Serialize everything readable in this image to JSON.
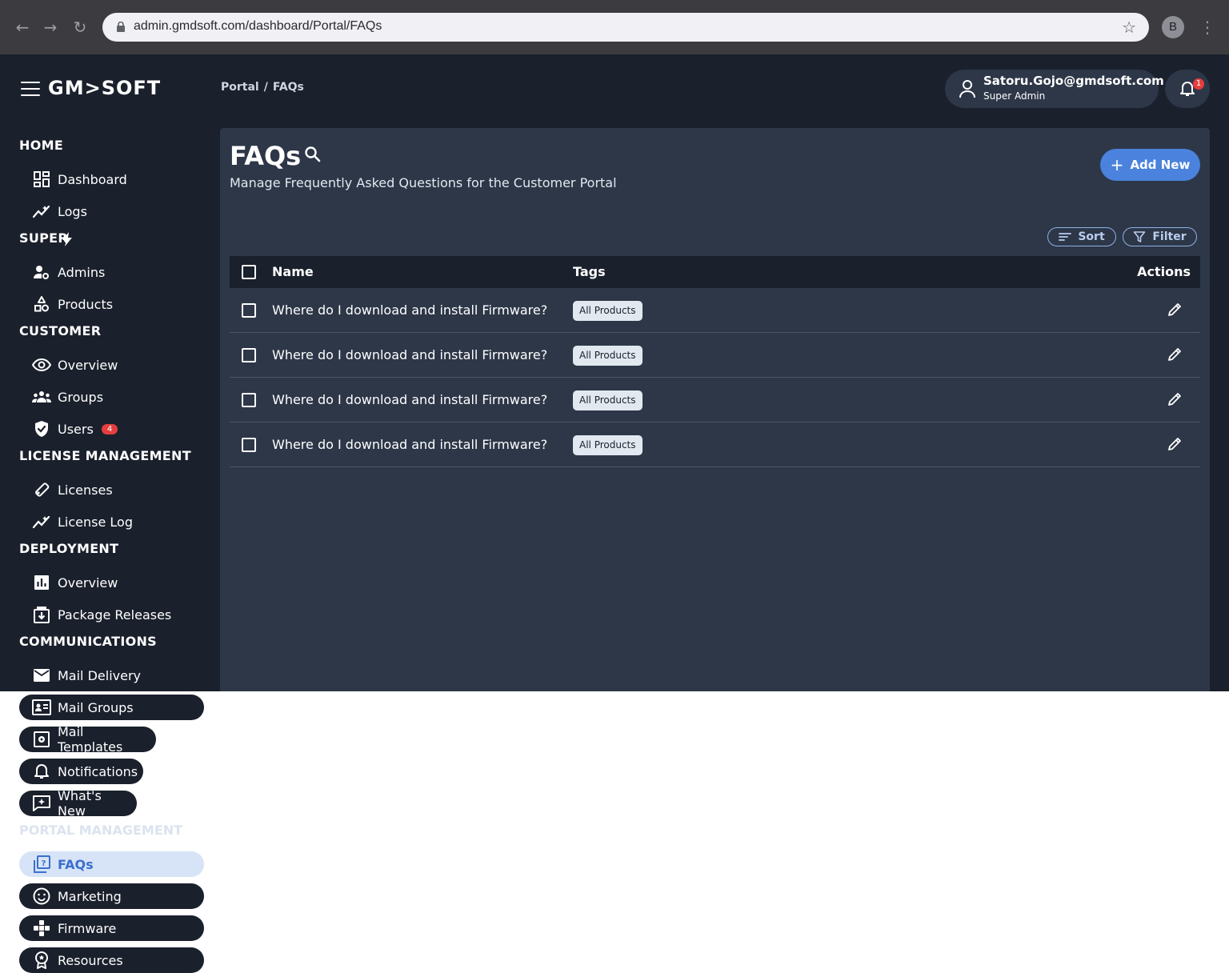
{
  "browser": {
    "url": "admin.gmdsoft.com/dashboard/Portal/FAQs",
    "profile_initial": "B"
  },
  "app": {
    "logo": "GM>SOFT",
    "breadcrumb": [
      "Portal",
      "FAQs"
    ],
    "user": {
      "email": "Satoru.Gojo@gmdsoft.com",
      "role": "Super Admin"
    },
    "notification_count": "1"
  },
  "sidebar": {
    "sections": [
      {
        "title": "HOME",
        "items": [
          {
            "label": "Dashboard",
            "icon": "dashboard-icon"
          },
          {
            "label": "Logs",
            "icon": "chart-line-icon"
          }
        ]
      },
      {
        "title": "SUPER",
        "items": [
          {
            "label": "Admins",
            "icon": "admin-settings-icon"
          },
          {
            "label": "Products",
            "icon": "category-icon"
          }
        ]
      },
      {
        "title": "CUSTOMER",
        "items": [
          {
            "label": "Overview",
            "icon": "eye-icon"
          },
          {
            "label": "Groups",
            "icon": "groups-icon"
          },
          {
            "label": "Users",
            "icon": "shield-check-icon",
            "badge": "4"
          }
        ]
      },
      {
        "title": "LICENSE MANAGEMENT",
        "items": [
          {
            "label": "Licenses",
            "icon": "key-icon"
          },
          {
            "label": "License Log",
            "icon": "chart-line-icon"
          }
        ]
      },
      {
        "title": "DEPLOYMENT",
        "items": [
          {
            "label": "Overview",
            "icon": "bar-chart-icon"
          },
          {
            "label": "Package Releases",
            "icon": "download-box-icon"
          }
        ]
      },
      {
        "title": "COMMUNICATIONS",
        "items": [
          {
            "label": "Mail Delivery",
            "icon": "mail-icon"
          },
          {
            "label": "Mail Groups",
            "icon": "contact-card-icon"
          },
          {
            "label": "Mail Templates",
            "icon": "template-icon"
          },
          {
            "label": "Notifications",
            "icon": "bell-icon"
          },
          {
            "label": "What's New",
            "icon": "sparkle-message-icon"
          }
        ]
      },
      {
        "title": "PORTAL MANAGEMENT",
        "items": [
          {
            "label": "FAQs",
            "icon": "faq-icon",
            "active": true
          },
          {
            "label": "Marketing",
            "icon": "smiley-icon"
          },
          {
            "label": "Firmware",
            "icon": "puzzle-icon"
          },
          {
            "label": "Resources",
            "icon": "badge-icon"
          }
        ]
      }
    ]
  },
  "main": {
    "title": "FAQs",
    "subtitle": "Manage Frequently Asked Questions for the Customer Portal",
    "add_button": "Add New",
    "sort_button": "Sort",
    "filter_button": "Filter",
    "table": {
      "columns": [
        "Name",
        "Tags",
        "Actions"
      ],
      "rows": [
        {
          "name": "Where do I download and install Firmware?",
          "tag": "All Products"
        },
        {
          "name": "Where do I download and install Firmware?",
          "tag": "All Products"
        },
        {
          "name": "Where do I download and install Firmware?",
          "tag": "All Products"
        },
        {
          "name": "Where do I download and install Firmware?",
          "tag": "All Products"
        }
      ]
    }
  },
  "colors": {
    "app_bg": "#1a202c",
    "panel_bg": "#2d3748",
    "accent": "#4a82dd",
    "badge": "#e53e3e"
  }
}
